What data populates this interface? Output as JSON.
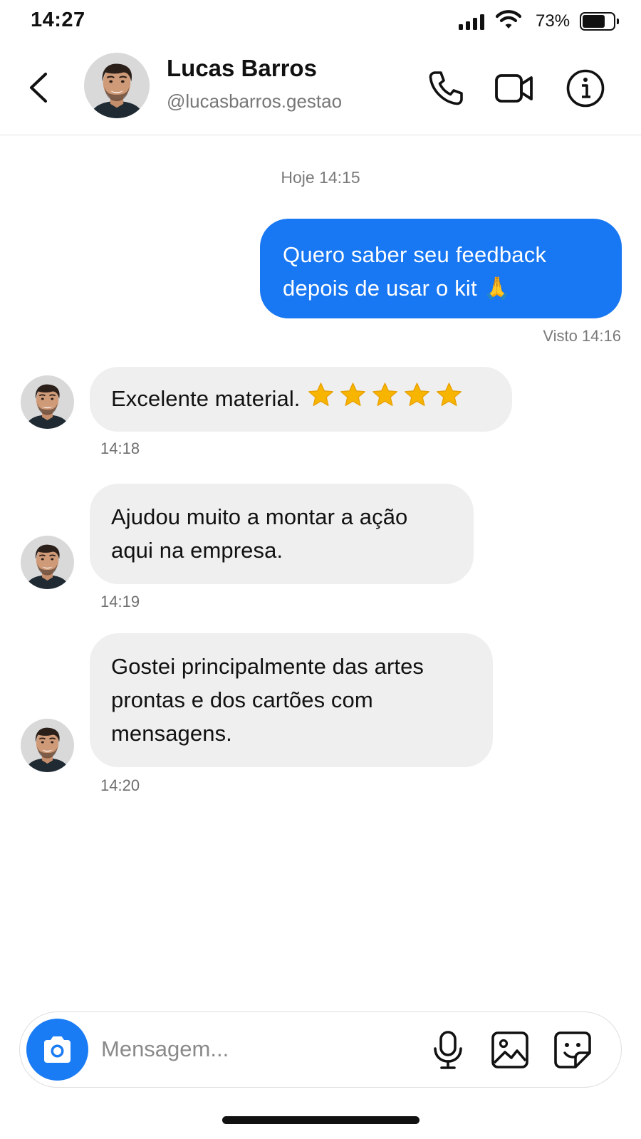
{
  "status_bar": {
    "time": "14:27",
    "battery_percent": "73%",
    "battery_level": 0.73,
    "signal_bars": 4
  },
  "header": {
    "contact_name": "Lucas Barros",
    "contact_handle": "@lucasbarros.gestao",
    "icons": [
      "chevron-left-icon",
      "phone-icon",
      "video-camera-icon",
      "info-icon"
    ]
  },
  "chat": {
    "day_label": "Hoje 14:15",
    "outgoing": {
      "line1": "Quero saber seu feedback",
      "line2": "depois de usar o kit",
      "emoji": "🙏",
      "seen": "Visto 14:16"
    },
    "incoming": [
      {
        "lines": [
          "Excelente material."
        ],
        "time": "14:18",
        "stars": 5
      },
      {
        "lines": [
          "Ajudou muito a montar a ação",
          "aqui na empresa."
        ],
        "time": "14:19"
      },
      {
        "lines": [
          "Gostei principalmente das artes",
          "prontas e dos cartões com",
          "mensagens."
        ],
        "time": "14:20"
      }
    ]
  },
  "composer": {
    "placeholder": "Mensagem...",
    "icons": [
      "camera-icon",
      "microphone-icon",
      "image-icon",
      "sticker-icon"
    ]
  },
  "colors": {
    "accent": "#1877f2",
    "incoming_bubble": "#efefef",
    "star": "#f7b500"
  }
}
